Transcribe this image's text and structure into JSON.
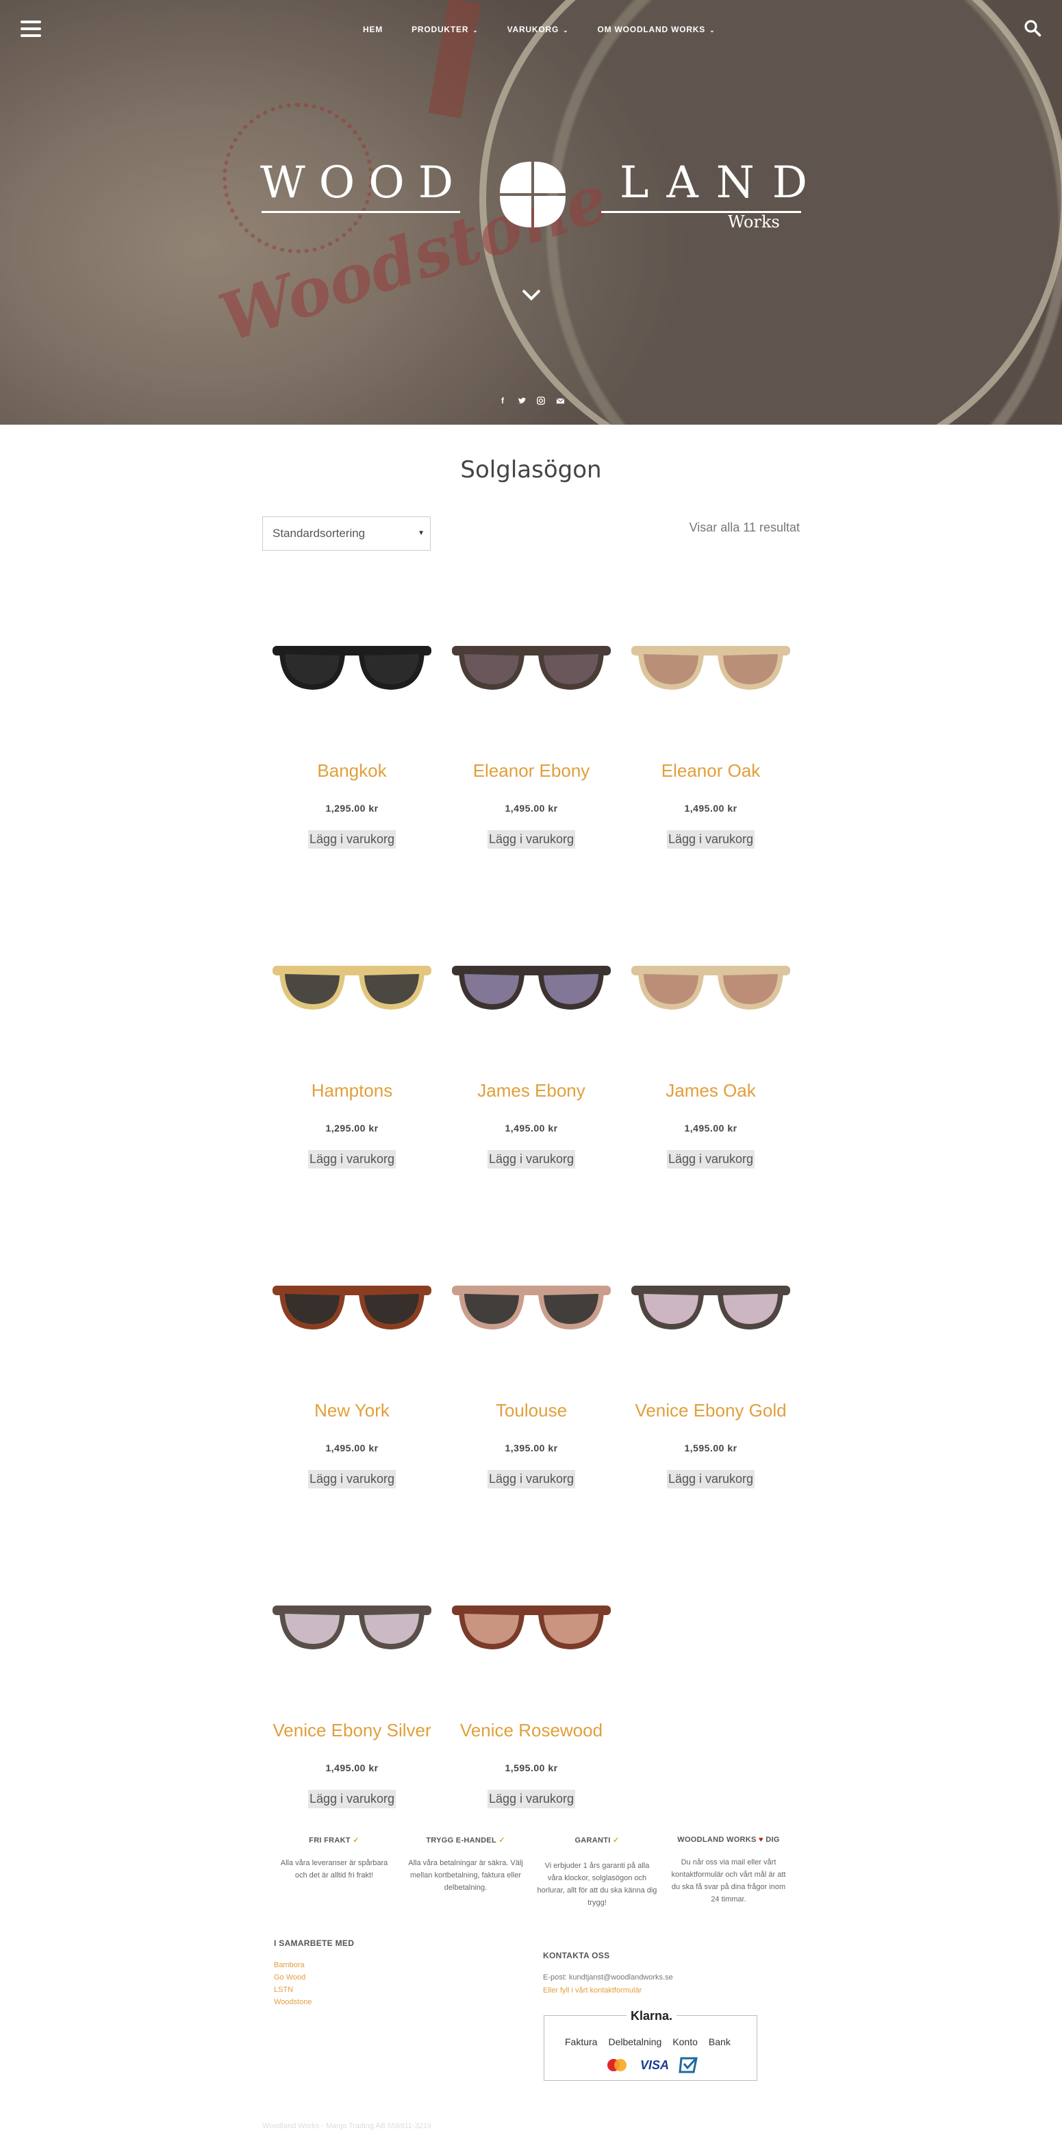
{
  "nav": {
    "items": [
      {
        "label": "Hem",
        "has_dropdown": false
      },
      {
        "label": "Produkter",
        "has_dropdown": true
      },
      {
        "label": "Varukorg",
        "has_dropdown": true
      },
      {
        "label": "Om Woodland Works",
        "has_dropdown": true
      }
    ]
  },
  "hero": {
    "logo_left": "WOOD",
    "logo_right": "LAND",
    "logo_sub": "Works",
    "stamp_text": "Woodstone"
  },
  "page_title": "Solglasögon",
  "sort": {
    "selected": "Standardsortering"
  },
  "results_text": "Visar alla 11 resultat",
  "products": [
    {
      "name": "Bangkok",
      "price": "1,295.00 kr",
      "button": "Lägg i varukorg",
      "frame": "#1d1d1d",
      "lens": "#2e2e2e"
    },
    {
      "name": "Eleanor Ebony",
      "price": "1,495.00 kr",
      "button": "Lägg i varukorg",
      "frame": "#4a3c36",
      "lens": "#6d5a60"
    },
    {
      "name": "Eleanor Oak",
      "price": "1,495.00 kr",
      "button": "Lägg i varukorg",
      "frame": "#dcc49d",
      "lens": "#b58a74"
    },
    {
      "name": "Hamptons",
      "price": "1,295.00 kr",
      "button": "Lägg i varukorg",
      "frame": "#e2c67e",
      "lens": "#3a3a3a"
    },
    {
      "name": "James Ebony",
      "price": "1,495.00 kr",
      "button": "Lägg i varukorg",
      "frame": "#3c3330",
      "lens": "#8a7ea2"
    },
    {
      "name": "James Oak",
      "price": "1,495.00 kr",
      "button": "Lägg i varukorg",
      "frame": "#dcc49d",
      "lens": "#b98873"
    },
    {
      "name": "New York",
      "price": "1,495.00 kr",
      "button": "Lägg i varukorg",
      "frame": "#8b3d22",
      "lens": "#2d2d2d"
    },
    {
      "name": "Toulouse",
      "price": "1,395.00 kr",
      "button": "Lägg i varukorg",
      "frame": "#c99e8c",
      "lens": "#333333"
    },
    {
      "name": "Venice Ebony Gold",
      "price": "1,595.00 kr",
      "button": "Lägg i varukorg",
      "frame": "#4f4541",
      "lens": "#d8c2d0"
    },
    {
      "name": "Venice Ebony Silver",
      "price": "1,495.00 kr",
      "button": "Lägg i varukorg",
      "frame": "#5a4e48",
      "lens": "#d7c6d2"
    },
    {
      "name": "Venice Rosewood",
      "price": "1,595.00 kr",
      "button": "Lägg i varukorg",
      "frame": "#7a3b28",
      "lens": "#d2a08a"
    }
  ],
  "features": [
    {
      "title": "FRI FRAKT",
      "mark": "✓",
      "text": "Alla våra leveranser är spårbara och det är alltid fri frakt!"
    },
    {
      "title": "TRYGG E-HANDEL",
      "mark": "✓",
      "text": "Alla våra betalningar är säkra. Välj mellan kortbetalning, faktura eller delbetalning."
    },
    {
      "title": "GARANTI",
      "mark": "✓",
      "text": "Vi erbjuder 1 års garanti på alla våra klockor, solglasögon och horlurar, allt för att du ska känna dig trygg!"
    },
    {
      "title_a": "WOODLAND WORKS",
      "title_b": "DIG",
      "text": "Du når oss via mail eller vårt kontaktformulär och vårt mål är att du ska få svar på dina frågor inom 24 timmar."
    }
  ],
  "partners": {
    "title": "I SAMARBETE MED",
    "links": [
      "Bambora",
      "Go Wood",
      "LSTN",
      "Woodstone"
    ]
  },
  "contact": {
    "title": "KONTAKTA OSS",
    "email": "E-post: kundtjanst@woodlandworks.se",
    "form_link": "Eller fyll i vårt kontaktformulär"
  },
  "klarna": {
    "brand": "Klarna.",
    "options": [
      "Faktura",
      "Delbetalning",
      "Konto",
      "Bank"
    ]
  },
  "footer": "Woodland Works - Manjo Trading AB 556911-3219",
  "colors": {
    "accent": "#e19f3b",
    "text": "#555555"
  }
}
